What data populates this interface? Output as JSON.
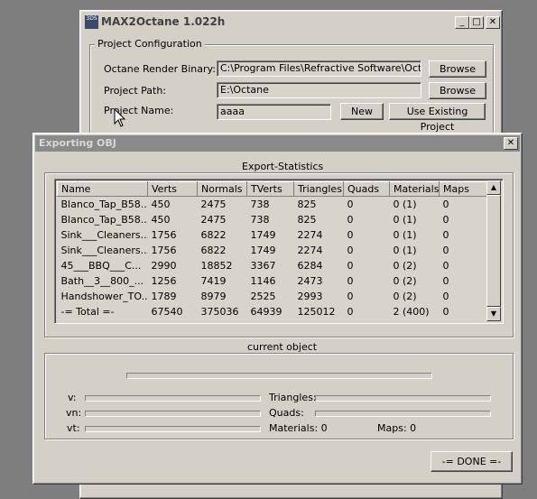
{
  "main_window": {
    "app_icon_text": "3DS",
    "title": "MAX2Octane 1.022h",
    "minimize_symbol": "_",
    "maximize_symbol": "□",
    "close_symbol": "✕",
    "group_title": "Project Configuration",
    "render_binary_label": "Octane Render Binary:",
    "render_binary_value": "C:\\Program Files\\Refractive Software\\Octane",
    "project_path_label": "Project Path:",
    "project_path_value": "E:\\Octane",
    "project_name_label": "Project Name:",
    "project_name_value": "aaaa",
    "browse_label": "Browse",
    "new_label": "New",
    "use_existing_label": "Use Existing Project"
  },
  "export_dialog": {
    "title": "Exporting OBJ",
    "close_symbol": "✕",
    "stats_group_title": "Export-Statistics",
    "columns": [
      "Name",
      "Verts",
      "Normals",
      "TVerts",
      "Triangles",
      "Quads",
      "Materials",
      "Maps"
    ],
    "rows": [
      [
        "Blanco_Tap_B58...",
        "450",
        "2475",
        "738",
        "825",
        "0",
        "0 (1)",
        "0"
      ],
      [
        "Blanco_Tap_B58...",
        "450",
        "2475",
        "738",
        "825",
        "0",
        "0 (1)",
        "0"
      ],
      [
        "Sink___Cleaners...",
        "1756",
        "6822",
        "1749",
        "2274",
        "0",
        "0 (1)",
        "0"
      ],
      [
        "Sink___Cleaners...",
        "1756",
        "6822",
        "1749",
        "2274",
        "0",
        "0 (1)",
        "0"
      ],
      [
        "45___BBQ___C...",
        "2990",
        "18852",
        "3367",
        "6284",
        "0",
        "0 (2)",
        "0"
      ],
      [
        "Bath__3__800_...",
        "1256",
        "7419",
        "1146",
        "2473",
        "0",
        "0 (2)",
        "0"
      ],
      [
        "Handshower_TO...",
        "1789",
        "8979",
        "2525",
        "2993",
        "0",
        "0 (2)",
        "0"
      ],
      [
        "-= Total =-",
        "67540",
        "375036",
        "64939",
        "125012",
        "0",
        "2 (400)",
        "0"
      ]
    ],
    "scroll_up": "▲",
    "scroll_down": "▼",
    "current_group_title": "current object",
    "v_label": "v:",
    "vn_label": "vn:",
    "vt_label": "vt:",
    "triangles_label": "Triangles:",
    "quads_label": "Quads:",
    "materials_label": "Materials: 0",
    "maps_label": "Maps:  0",
    "done_label": "-= DONE =-"
  }
}
